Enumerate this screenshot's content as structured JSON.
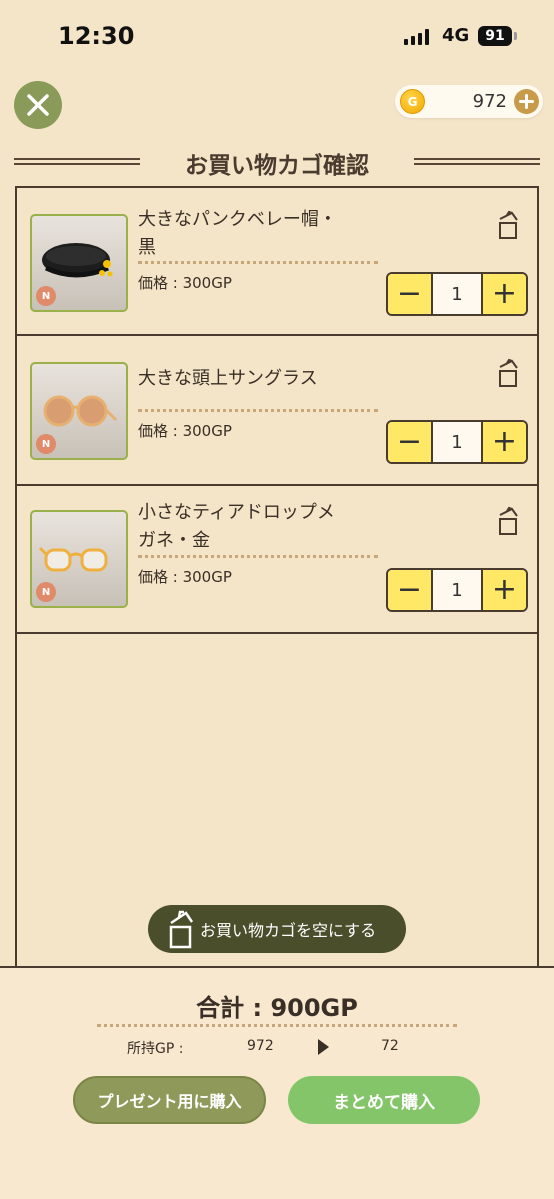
{
  "status_bar": {
    "time": "12:30",
    "network": "4G",
    "battery": "91"
  },
  "header": {
    "close_icon": "close-icon",
    "coins": "972",
    "coin_icon": "coin-icon",
    "add_coins_icon": "plus-circle-icon"
  },
  "title": "お買い物カゴ確認",
  "cart": {
    "items": [
      {
        "name_line1": "大きなパンクベレー帽・",
        "name_line2": "黒",
        "price": "価格 : 300GP",
        "rarity": "N",
        "quantity": "1",
        "thumbnail": "black-beret"
      },
      {
        "name_line1": "大きな頭上サングラス",
        "name_line2": "",
        "price": "価格 : 300GP",
        "rarity": "N",
        "quantity": "1",
        "thumbnail": "round-sunglasses"
      },
      {
        "name_line1": "小さなティアドロップメ",
        "name_line2": "ガネ・金",
        "price": "価格 : 300GP",
        "rarity": "N",
        "quantity": "1",
        "thumbnail": "gold-glasses"
      }
    ],
    "minus_label": "−",
    "plus_label": "+",
    "empty_cart_label": "お買い物カゴを空にする"
  },
  "footer": {
    "total": "合計 : 900GP",
    "gp_label": "所持GP :",
    "gp_current": "972",
    "gp_after": "72",
    "gift_button": "プレゼント用に購入",
    "buy_button": "まとめて購入"
  },
  "colors": {
    "background": "#f4e4c8",
    "stepper_button": "#ffe866",
    "buy_button": "#84c56a",
    "gift_button": "#8f9a5a",
    "close_button": "#8a9a58",
    "empty_cart_button": "#4a4e2a"
  }
}
